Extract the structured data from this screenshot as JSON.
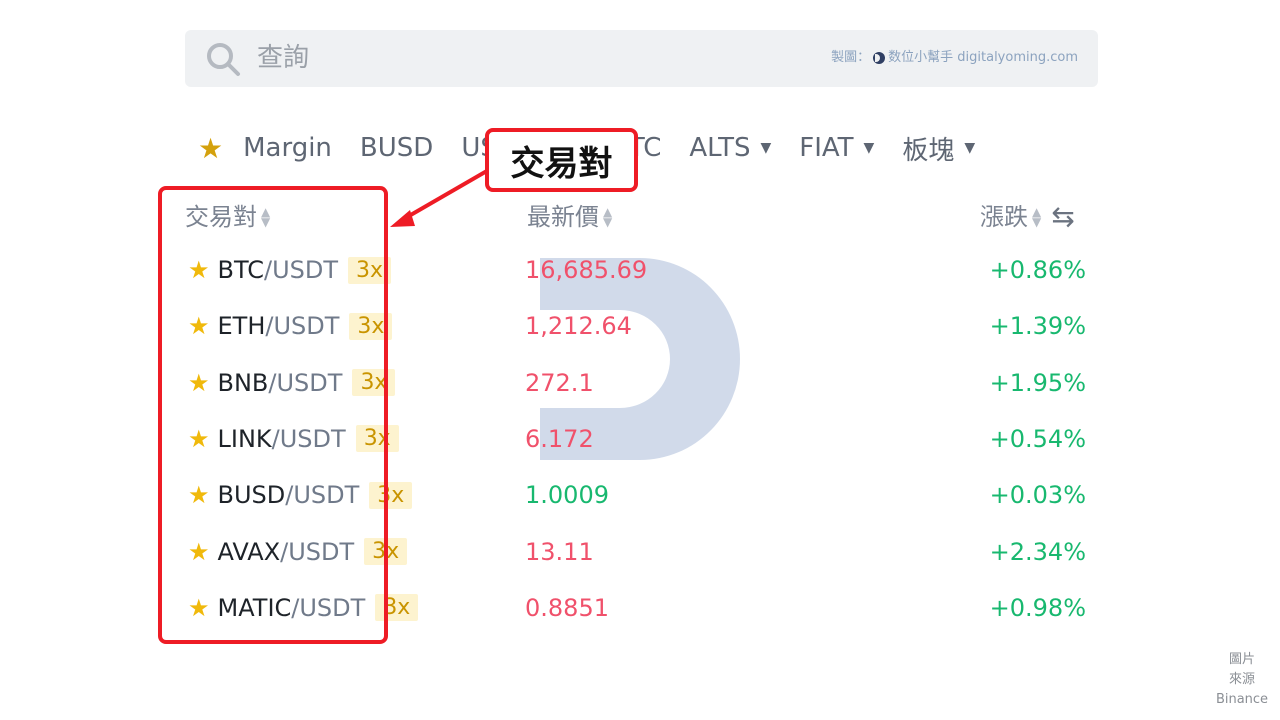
{
  "search": {
    "placeholder": "查詢",
    "credit_prefix": "製圖：",
    "credit_text": "数位小幫手 digitalyoming.com"
  },
  "tabs": [
    {
      "label": "Margin",
      "has_caret": false
    },
    {
      "label": "BUSD",
      "has_caret": false
    },
    {
      "label": "US",
      "has_caret": false
    },
    {
      "label": "TC",
      "has_caret": false
    },
    {
      "label": "ALTS",
      "has_caret": true
    },
    {
      "label": "FIAT",
      "has_caret": true
    },
    {
      "label": "板塊",
      "has_caret": true
    }
  ],
  "headers": {
    "pair": "交易對",
    "last_price": "最新價",
    "change": "漲跌"
  },
  "rows": [
    {
      "base": "BTC",
      "quote": "/USDT",
      "leverage": "3x",
      "price": "16,685.69",
      "price_color": "#f0516b",
      "change": "+0.86%"
    },
    {
      "base": "ETH",
      "quote": "/USDT",
      "leverage": "3x",
      "price": "1,212.64",
      "price_color": "#f0516b",
      "change": "+1.39%"
    },
    {
      "base": "BNB",
      "quote": "/USDT",
      "leverage": "3x",
      "price": "272.1",
      "price_color": "#f0516b",
      "change": "+1.95%"
    },
    {
      "base": "LINK",
      "quote": "/USDT",
      "leverage": "3x",
      "price": "6.172",
      "price_color": "#f0516b",
      "change": "+0.54%"
    },
    {
      "base": "BUSD",
      "quote": "/USDT",
      "leverage": "3x",
      "price": "1.0009",
      "price_color": "#18b86f",
      "change": "+0.03%"
    },
    {
      "base": "AVAX",
      "quote": "/USDT",
      "leverage": "3x",
      "price": "13.11",
      "price_color": "#f0516b",
      "change": "+2.34%"
    },
    {
      "base": "MATIC",
      "quote": "/USDT",
      "leverage": "3x",
      "price": "0.8851",
      "price_color": "#f0516b",
      "change": "+0.98%"
    }
  ],
  "annotation": {
    "label": "交易對"
  },
  "source_note": [
    "圖片",
    "來源",
    "Binance"
  ],
  "colors": {
    "accent_yellow": "#f0b90b",
    "down_red": "#f0516b",
    "up_green": "#18b86f",
    "annotation_red": "#ee1c25"
  }
}
